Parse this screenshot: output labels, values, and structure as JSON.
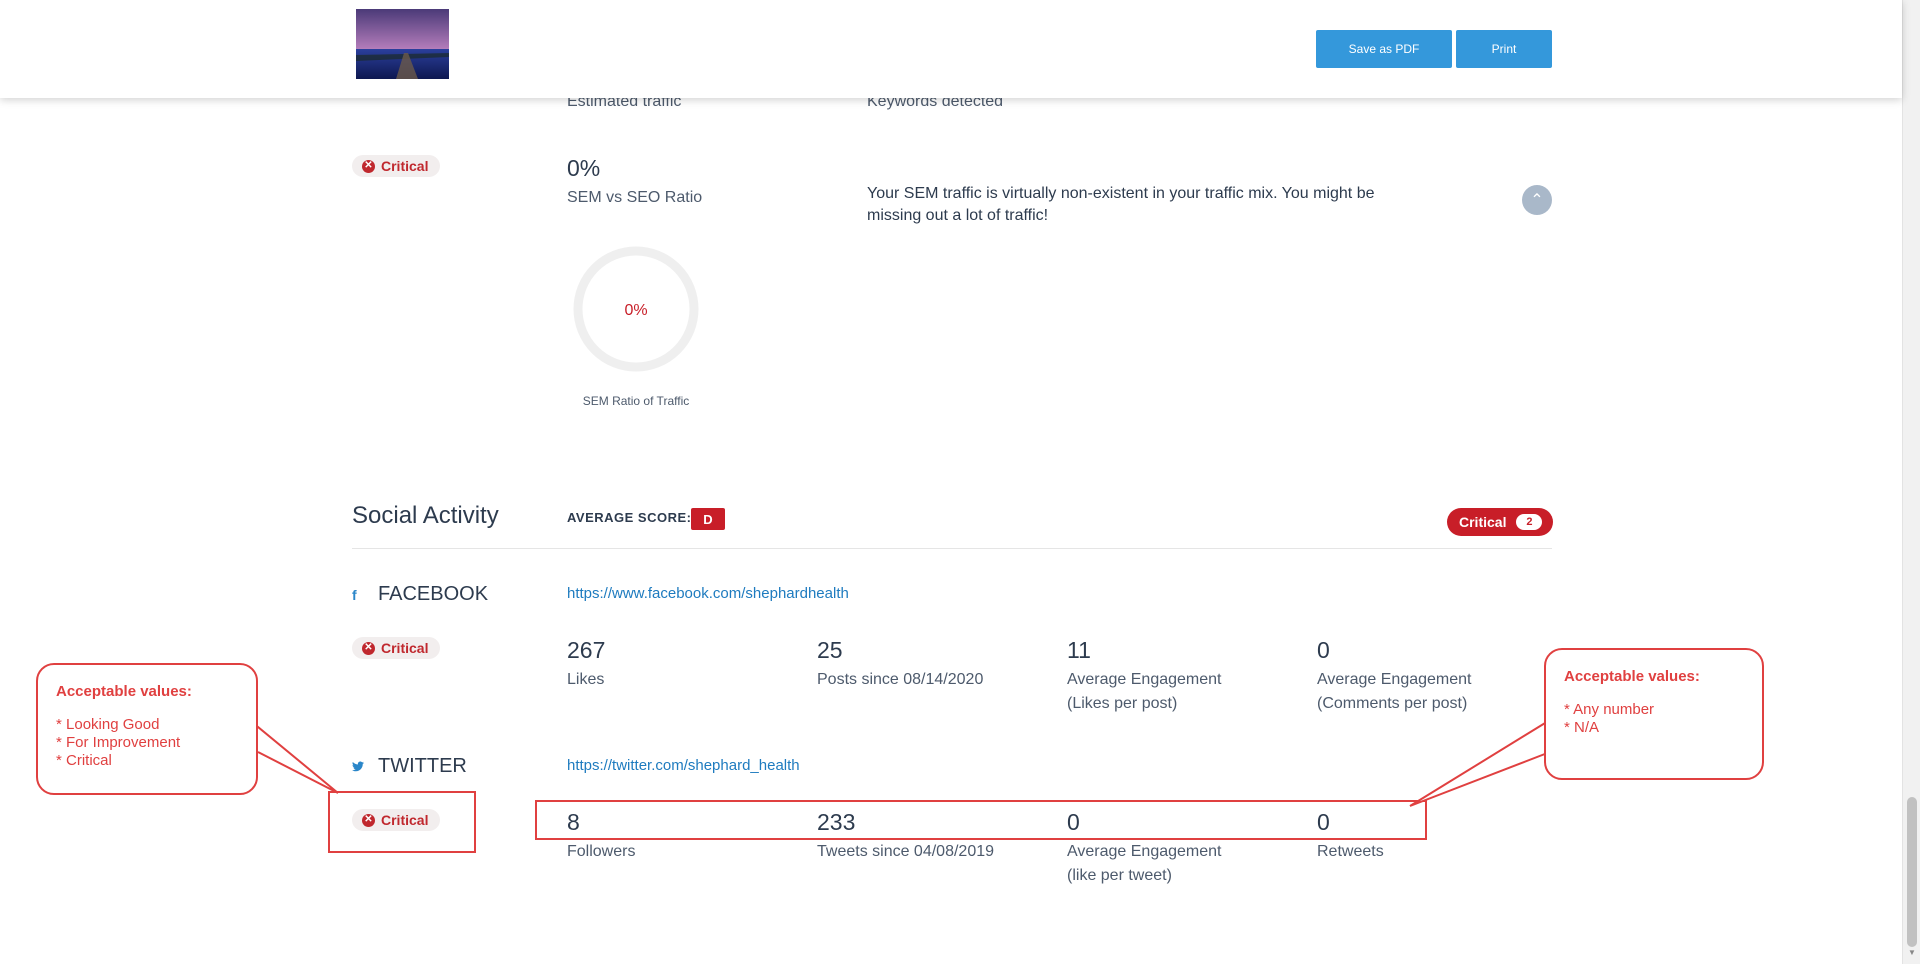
{
  "header": {
    "save_pdf_label": "Save as PDF",
    "print_label": "Print"
  },
  "sem": {
    "top_label_left": "Estimated traffic",
    "top_label_right": "Keywords detected",
    "status": "Critical",
    "value": "0%",
    "label": "SEM vs SEO Ratio",
    "description_line1": "Your SEM traffic is virtually non-existent in your traffic mix. You might be",
    "description_line2": "missing out a lot of traffic!",
    "donut_value": "0%",
    "donut_caption": "SEM Ratio of Traffic",
    "donut_fraction": 0
  },
  "social": {
    "title": "Social Activity",
    "average_score_label": "AVERAGE SCORE:",
    "average_score": "D",
    "critical_label": "Critical",
    "critical_count": "2",
    "facebook": {
      "name": "FACEBOOK",
      "icon": "facebook-icon",
      "url": "https://www.facebook.com/shephardhealth",
      "status": "Critical",
      "metrics": [
        {
          "value": "267",
          "label1": "Likes",
          "label2": ""
        },
        {
          "value": "25",
          "label1": "Posts since 08/14/2020",
          "label2": ""
        },
        {
          "value": "11",
          "label1": "Average Engagement",
          "label2": "(Likes per post)"
        },
        {
          "value": "0",
          "label1": "Average Engagement",
          "label2": "(Comments per post)"
        }
      ]
    },
    "twitter": {
      "name": "TWITTER",
      "icon": "twitter-icon",
      "url": "https://twitter.com/shephard_health",
      "status": "Critical",
      "metrics": [
        {
          "value": "8",
          "label1": "Followers",
          "label2": ""
        },
        {
          "value": "233",
          "label1": "Tweets since 04/08/2019",
          "label2": ""
        },
        {
          "value": "0",
          "label1": "Average Engagement",
          "label2": "(like per tweet)"
        },
        {
          "value": "0",
          "label1": "Retweets",
          "label2": ""
        }
      ]
    }
  },
  "callouts": {
    "left": {
      "title": "Acceptable values:",
      "items": [
        "* Looking Good",
        "* For Improvement",
        "* Critical"
      ]
    },
    "right": {
      "title": "Acceptable values:",
      "items": [
        "* Any number",
        "* N/A"
      ]
    }
  },
  "colors": {
    "accent": "#3498db",
    "critical": "#c81e28",
    "annotation": "#e04040",
    "link": "#1e7bbf"
  }
}
